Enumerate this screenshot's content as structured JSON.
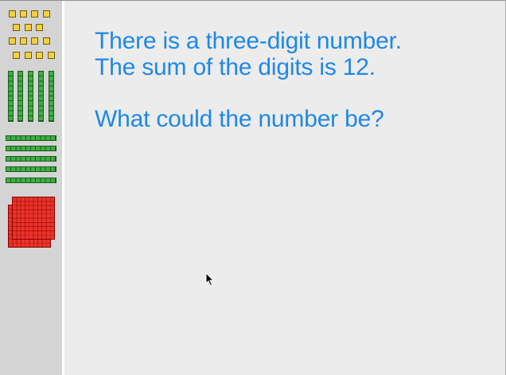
{
  "question": {
    "line1": "There is a three-digit number.",
    "line2": "The sum of the digits is 12.",
    "line3": "What could the number be?"
  },
  "colors": {
    "question_text": "#1e88e5",
    "canvas_background": "#ececec",
    "sidebar_background": "#d4d4d4",
    "unit_block": "#f4d03f",
    "ten_rod": "#3cb043",
    "hundred_flat": "#e8332b"
  },
  "sidebar": {
    "tools": [
      {
        "name": "unit-blocks-icon"
      },
      {
        "name": "vertical-ten-rods-icon"
      },
      {
        "name": "horizontal-ten-rods-icon"
      },
      {
        "name": "hundred-flats-icon"
      }
    ]
  },
  "pointer": {
    "icon": "mouse-cursor-icon"
  }
}
